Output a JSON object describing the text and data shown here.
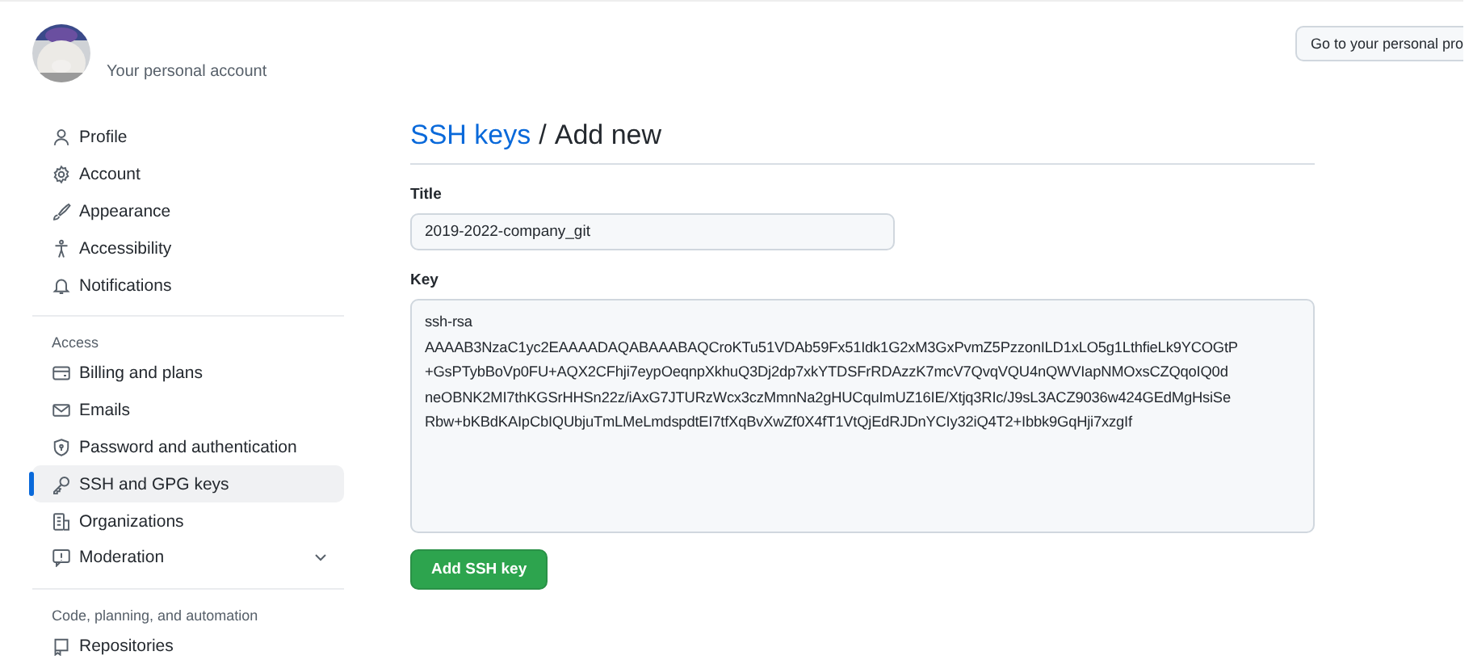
{
  "account": {
    "subtitle": "Your personal account"
  },
  "header_button": {
    "label": "Go to your personal pro"
  },
  "sidebar": {
    "groups": [
      {
        "items": [
          {
            "label": "Profile",
            "selected": false
          },
          {
            "label": "Account",
            "selected": false
          },
          {
            "label": "Appearance",
            "selected": false
          },
          {
            "label": "Accessibility",
            "selected": false
          },
          {
            "label": "Notifications",
            "selected": false
          }
        ]
      },
      {
        "heading": "Access",
        "items": [
          {
            "label": "Billing and plans",
            "selected": false
          },
          {
            "label": "Emails",
            "selected": false
          },
          {
            "label": "Password and authentication",
            "selected": false
          },
          {
            "label": "SSH and GPG keys",
            "selected": true
          },
          {
            "label": "Organizations",
            "selected": false
          },
          {
            "label": "Moderation",
            "selected": false,
            "has_submenu": true
          }
        ]
      },
      {
        "heading": "Code, planning, and automation",
        "items": [
          {
            "label": "Repositories",
            "selected": false
          }
        ]
      }
    ]
  },
  "main": {
    "breadcrumb_link": "SSH keys",
    "separator": "/",
    "title": "Add new",
    "title_field": {
      "label": "Title",
      "value": "2019-2022-company_git"
    },
    "key_field": {
      "label": "Key",
      "value": "ssh-rsa\nAAAAB3NzaC1yc2EAAAADAQABAAABAQCroKTu51VDAb59Fx51Idk1G2xM3GxPvmZ5PzzonILD1xLO5g1LthfieLk9YCOGtP\n+GsPTybBoVp0FU+AQX2CFhji7eypOeqnpXkhuQ3Dj2dp7xkYTDSFrRDAzzK7mcV7QvqVQU4nQWVIapNMOxsCZQqoIQ0d\nneOBNK2MI7thKGSrHHSn22z/iAxG7JTURzWcx3czMmnNa2gHUCquImUZ16IE/Xtjq3RIc/J9sL3ACZ9036w424GEdMgHsiSe\nRbw+bKBdKAIpCbIQUbjuTmLMeLmdspdtEI7tfXqBvXwZf0X4fT1VtQjEdRJDnYCIy32iQ4T2+Ibbk9GqHji7xzgIf"
    },
    "submit": "Add SSH key"
  }
}
